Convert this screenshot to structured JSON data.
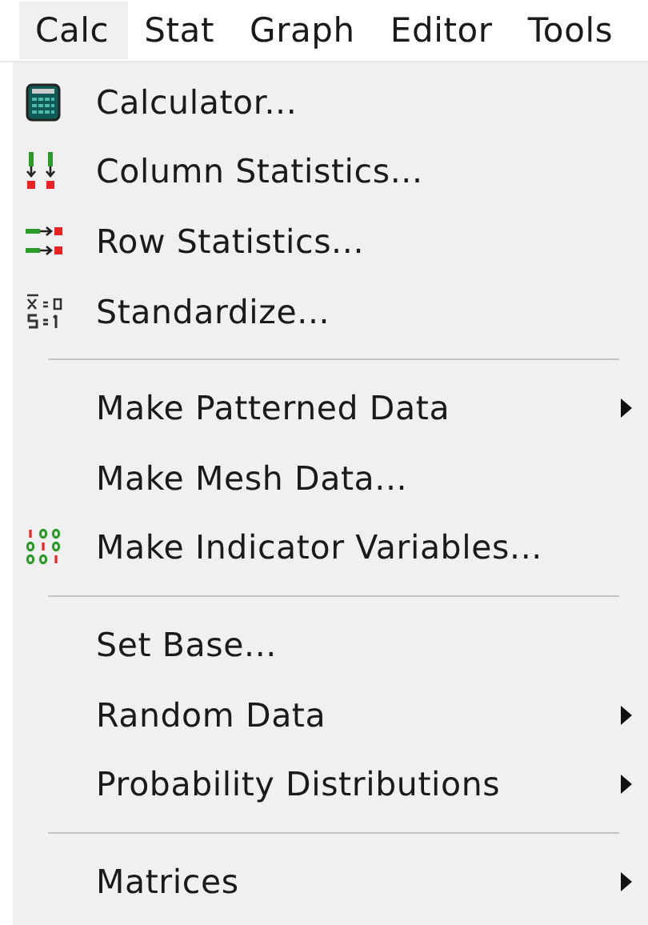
{
  "menubar": [
    {
      "label": "Calc",
      "selected": true
    },
    {
      "label": "Stat",
      "selected": false
    },
    {
      "label": "Graph",
      "selected": false
    },
    {
      "label": "Editor",
      "selected": false
    },
    {
      "label": "Tools",
      "selected": false
    }
  ],
  "menu": [
    {
      "kind": "item",
      "label": "Calculator...",
      "submenu": false
    },
    {
      "kind": "item",
      "label": "Column Statistics...",
      "submenu": false
    },
    {
      "kind": "item",
      "label": "Row Statistics...",
      "submenu": false
    },
    {
      "kind": "item",
      "label": "Standardize...",
      "submenu": false
    },
    {
      "kind": "separator"
    },
    {
      "kind": "item",
      "label": "Make Patterned Data",
      "submenu": true
    },
    {
      "kind": "item",
      "label": "Make Mesh Data...",
      "submenu": false
    },
    {
      "kind": "item",
      "label": "Make Indicator Variables...",
      "submenu": false
    },
    {
      "kind": "separator"
    },
    {
      "kind": "item",
      "label": "Set Base...",
      "submenu": false
    },
    {
      "kind": "item",
      "label": "Random Data",
      "submenu": true
    },
    {
      "kind": "item",
      "label": "Probability Distributions",
      "submenu": true
    },
    {
      "kind": "separator"
    },
    {
      "kind": "item",
      "label": "Matrices",
      "submenu": true
    }
  ]
}
